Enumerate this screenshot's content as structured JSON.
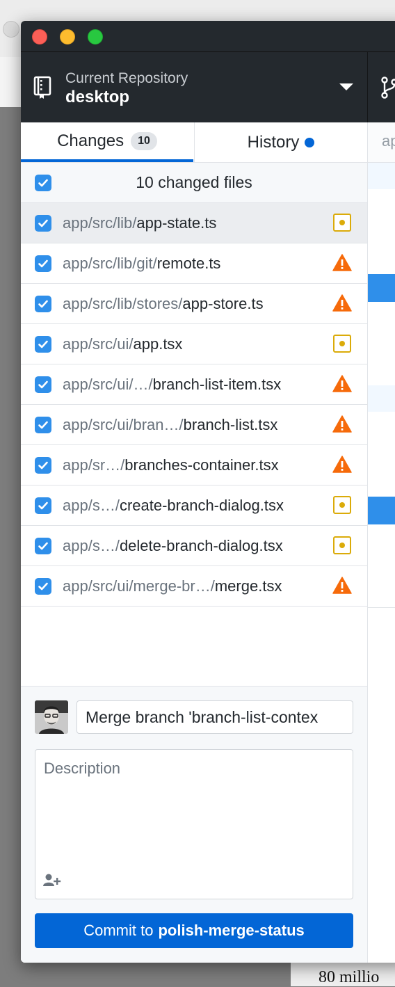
{
  "toolbar": {
    "repo_label": "Current Repository",
    "repo_name": "desktop"
  },
  "tabs": {
    "changes_label": "Changes",
    "changes_count": "10",
    "history_label": "History"
  },
  "changes": {
    "header_label": "10 changed files",
    "files": [
      {
        "dir": "app/src/lib/",
        "name": "app-state.ts",
        "status": "modified"
      },
      {
        "dir": "app/src/lib/git/",
        "name": "remote.ts",
        "status": "conflicted"
      },
      {
        "dir": "app/src/lib/stores/",
        "name": "app-store.ts",
        "status": "conflicted"
      },
      {
        "dir": "app/src/ui/",
        "name": "app.tsx",
        "status": "modified"
      },
      {
        "dir": "app/src/ui/…/",
        "name": "branch-list-item.tsx",
        "status": "conflicted"
      },
      {
        "dir": "app/src/ui/bran…/",
        "name": "branch-list.tsx",
        "status": "conflicted"
      },
      {
        "dir": "app/sr…/",
        "name": "branches-container.tsx",
        "status": "conflicted"
      },
      {
        "dir": "app/s…/",
        "name": "create-branch-dialog.tsx",
        "status": "modified"
      },
      {
        "dir": "app/s…/",
        "name": "delete-branch-dialog.tsx",
        "status": "modified"
      },
      {
        "dir": "app/src/ui/merge-br…/",
        "name": "merge.tsx",
        "status": "conflicted"
      }
    ]
  },
  "commit": {
    "summary": "Merge branch 'branch-list-contex",
    "description_placeholder": "Description",
    "button_prefix": "Commit to",
    "branch_name": "polish-merge-status"
  },
  "diff": {
    "tab_text": "ap"
  },
  "background": {
    "partial_text": "80 millio"
  },
  "colors": {
    "accent": "#0366d6",
    "checkbox": "#2f8fea",
    "modified": "#dbab09",
    "conflicted": "#f66a0a",
    "toolbar_bg": "#24292e"
  }
}
